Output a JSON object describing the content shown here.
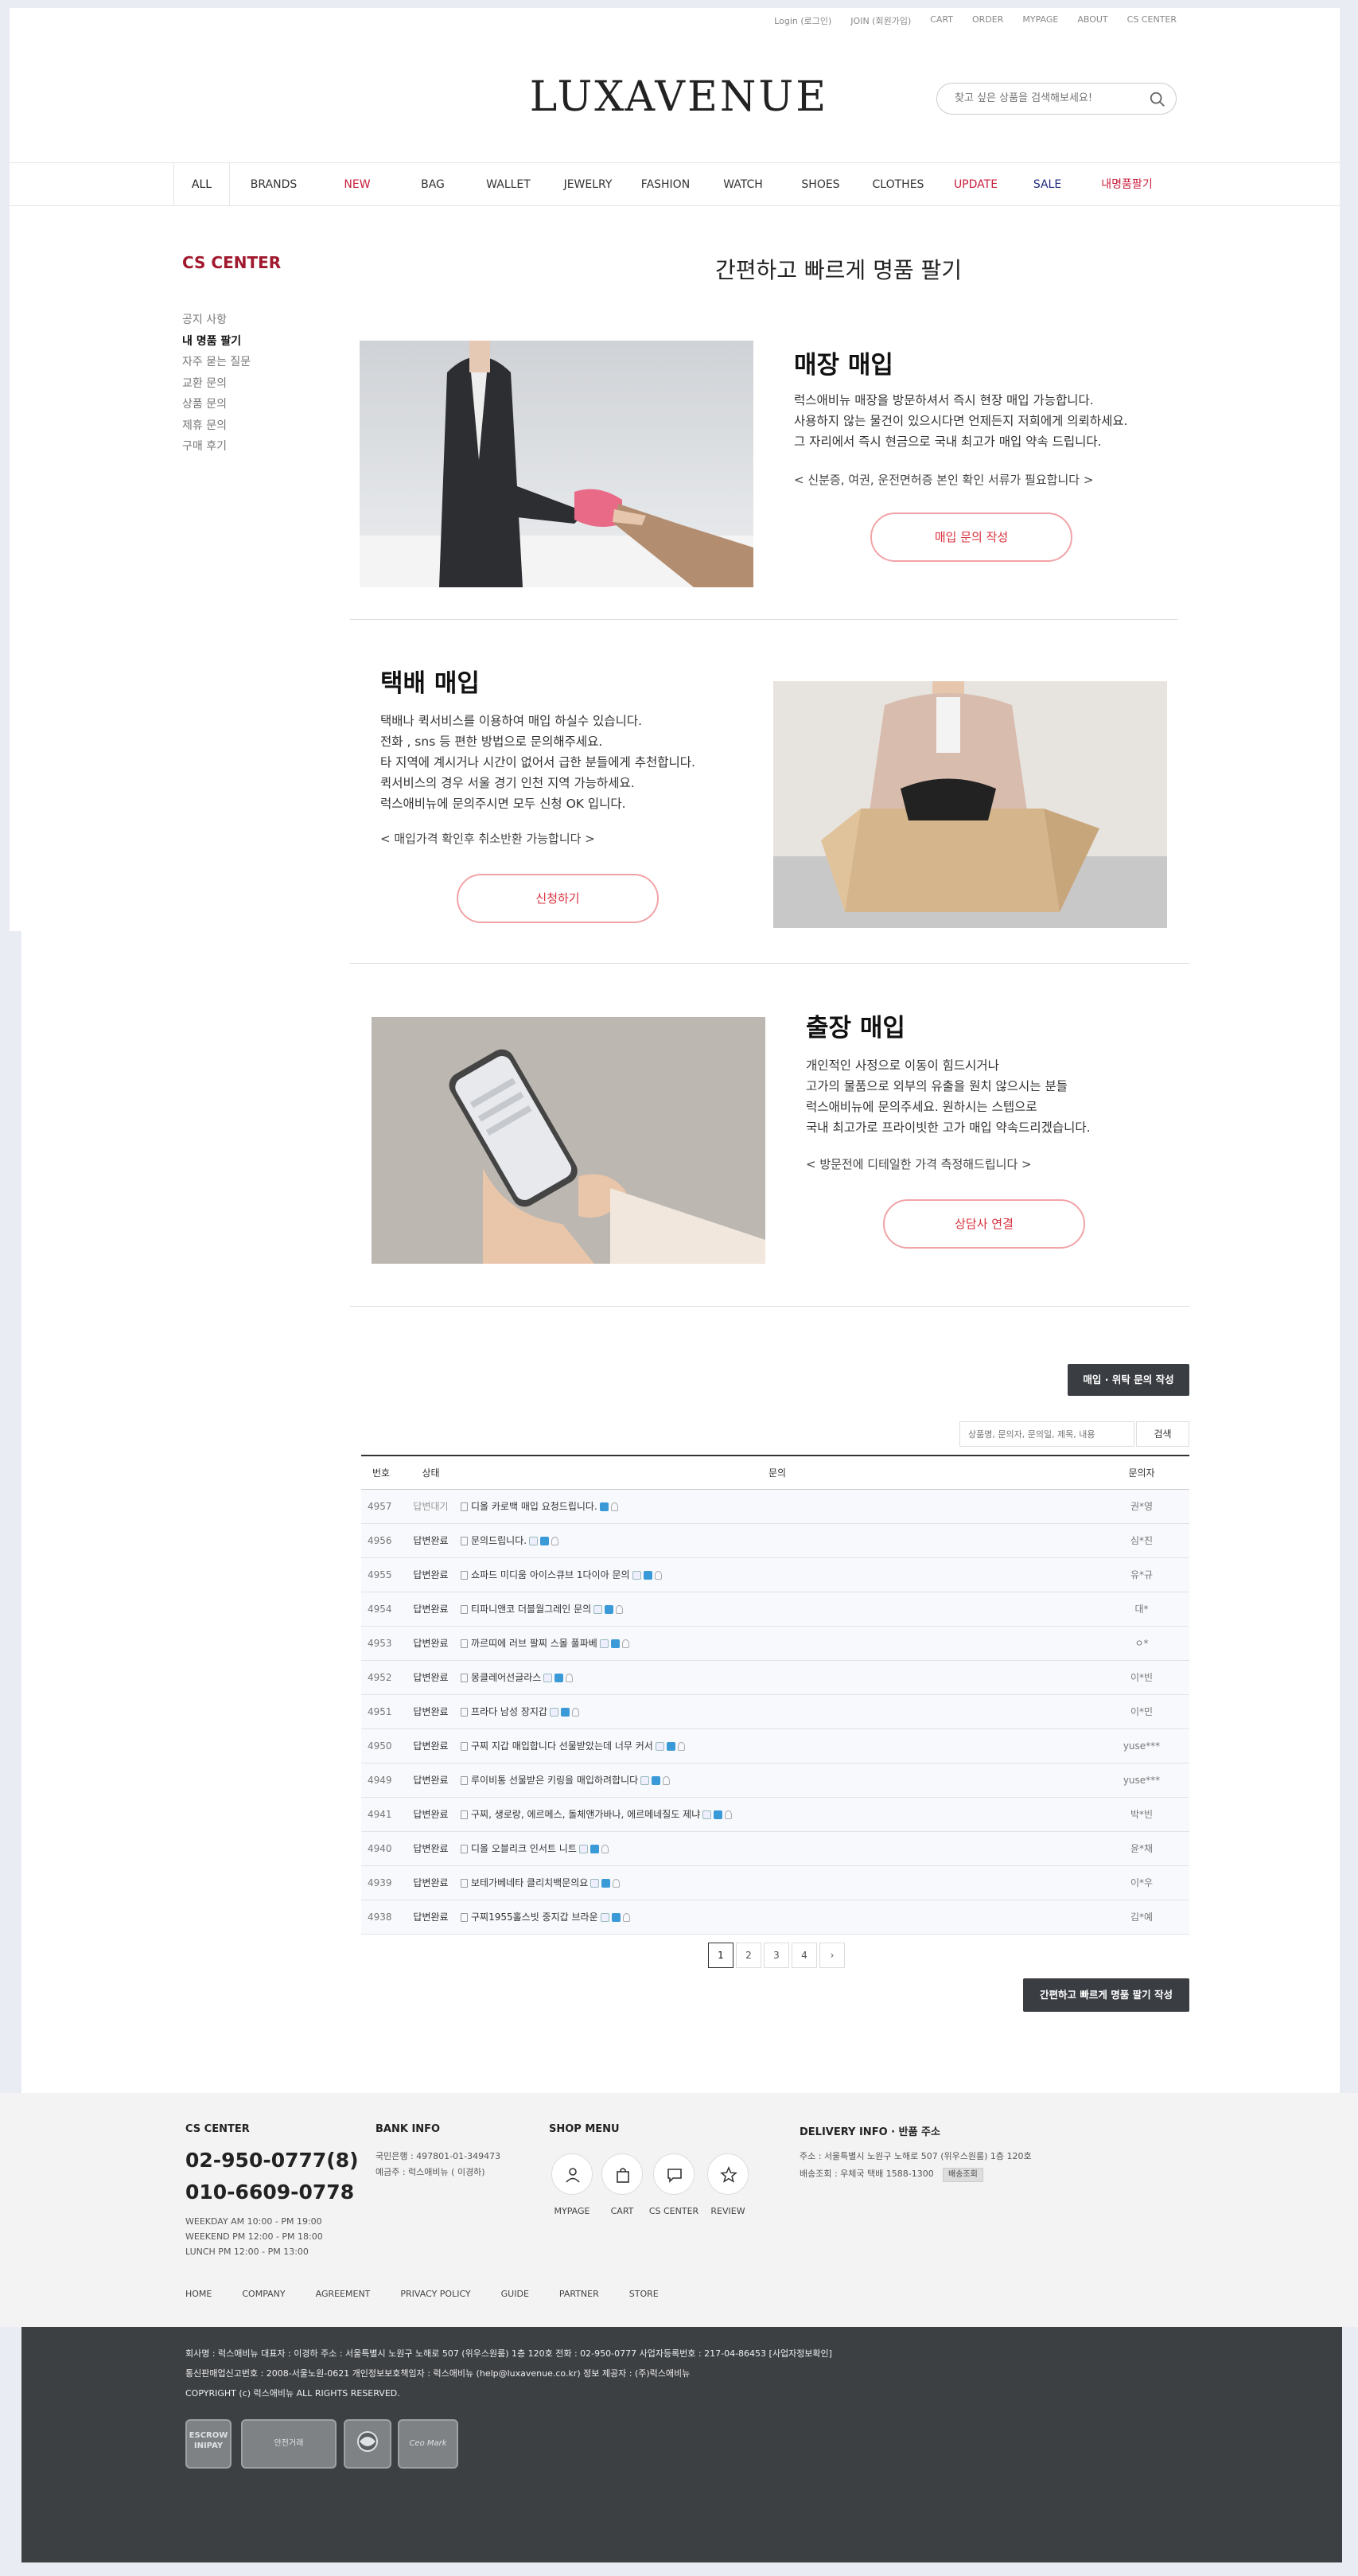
{
  "header": {
    "topnav": [
      "Login (로그인)",
      "JOIN (회원가입)",
      "CART",
      "ORDER",
      "MYPAGE",
      "ABOUT",
      "CS CENTER"
    ],
    "logo": "LUXAVENUE",
    "search_placeholder": "찾고 싶은 상품을 검색해보세요!"
  },
  "gnb": [
    {
      "label": "ALL",
      "color": "#222"
    },
    {
      "label": "BRANDS",
      "color": "#333"
    },
    {
      "label": "NEW",
      "color": "#c81e3c"
    },
    {
      "label": "BAG",
      "color": "#333"
    },
    {
      "label": "WALLET",
      "color": "#333"
    },
    {
      "label": "JEWELRY",
      "color": "#333"
    },
    {
      "label": "FASHION",
      "color": "#333"
    },
    {
      "label": "WATCH",
      "color": "#333"
    },
    {
      "label": "SHOES",
      "color": "#333"
    },
    {
      "label": "CLOTHES",
      "color": "#333"
    },
    {
      "label": "UPDATE",
      "color": "#c81e3c"
    },
    {
      "label": "SALE",
      "color": "#1c2a7a"
    },
    {
      "label": "내명품팔기",
      "color": "#c81e3c"
    }
  ],
  "sidebar": {
    "title": "CS CENTER",
    "items": [
      "공지 사항",
      "내 명품 팔기",
      "자주 묻는 질문",
      "교환 문의",
      "상품 문의",
      "제휴 문의",
      "구매 후기"
    ],
    "active_index": 1
  },
  "page_title": "간편하고 빠르게 명품 팔기",
  "sections": [
    {
      "title": "매장 매입",
      "lines": [
        "럭스애비뉴 매장을 방문하셔서 즉시 현장 매입 가능합니다.",
        "사용하지 않는 물건이 있으시다면 언제든지 저희에게 의뢰하세요.",
        "그 자리에서 즉시 현금으로 국내 최고가 매입 약속 드립니다."
      ],
      "note": "< 신분증, 여권, 운전면허증 본인 확인 서류가 필요합니다 >",
      "button": "매입 문의 작성"
    },
    {
      "title": "택배 매입",
      "lines": [
        "택배나 퀵서비스를 이용하여 매입 하실수 있습니다.",
        "전화 , sns 등 편한 방법으로 문의해주세요.",
        "타 지역에 계시거나 시간이 없어서 급한 분들에게 추천합니다.",
        "퀵서비스의 경우 서울 경기 인천 지역 가능하세요.",
        "럭스애비뉴에 문의주시면 모두 신청 OK 입니다."
      ],
      "note": "< 매입가격 확인후 취소반환 가능합니다 >",
      "button": "신청하기"
    },
    {
      "title": "출장 매입",
      "lines": [
        "개인적인 사정으로 이동이 힘드시거나",
        "고가의 물품으로 외부의 유출을 원치 않으시는 분들",
        "럭스애비뉴에 문의주세요. 원하시는 스텝으로",
        "국내 최고가로 프라이빗한 고가 매입 약속드리겠습니다."
      ],
      "note": "< 방문전에 디테일한 가격 측정해드립니다 >",
      "button": "상담사 연결"
    }
  ],
  "board": {
    "write_top": "매입 · 위탁 문의 작성",
    "search_placeholder": "상품명, 문의자, 문의일, 제목, 내용",
    "search_button": "검색",
    "columns": [
      "번호",
      "상태",
      "문의",
      "문의자"
    ],
    "rows": [
      {
        "no": "4957",
        "status": "답변대기",
        "title": "디올 카로백 매입 요청드립니다.",
        "writer": "권*영",
        "icons": [
          "n",
          "l"
        ]
      },
      {
        "no": "4956",
        "status": "답변완료",
        "title": "문의드립니다.",
        "writer": "심*진",
        "icons": [
          "p",
          "n",
          "l"
        ]
      },
      {
        "no": "4955",
        "status": "답변완료",
        "title": "쇼파드 미디움 아이스큐브 1다이아 문의",
        "writer": "유*규",
        "icons": [
          "p",
          "n",
          "l"
        ]
      },
      {
        "no": "4954",
        "status": "답변완료",
        "title": "티파니앤코 더블월그레인 문의",
        "writer": "대*",
        "icons": [
          "p",
          "n",
          "l"
        ]
      },
      {
        "no": "4953",
        "status": "답변완료",
        "title": "까르띠에 러브 팔찌 스몰 풀파베",
        "writer": "ㅇ*",
        "icons": [
          "p",
          "n",
          "l"
        ]
      },
      {
        "no": "4952",
        "status": "답변완료",
        "title": "몽클레어선글라스",
        "writer": "이*빈",
        "icons": [
          "p",
          "n",
          "l"
        ]
      },
      {
        "no": "4951",
        "status": "답변완료",
        "title": "프라다 남성 장지갑",
        "writer": "이*민",
        "icons": [
          "p",
          "n",
          "l"
        ]
      },
      {
        "no": "4950",
        "status": "답변완료",
        "title": "구찌 지갑 매입합니다 선물받았는데 너무 커서",
        "writer": "yuse***",
        "icons": [
          "p",
          "n",
          "l"
        ]
      },
      {
        "no": "4949",
        "status": "답변완료",
        "title": "루이비통 선물받은 키링을 매입하려합니다",
        "writer": "yuse***",
        "icons": [
          "p",
          "n",
          "l"
        ]
      },
      {
        "no": "4941",
        "status": "답변완료",
        "title": "구찌, 생로랑, 에르메스, 돌체앤가바나, 에르메네질도 제냐",
        "writer": "박*빈",
        "icons": [
          "p",
          "n",
          "l"
        ]
      },
      {
        "no": "4940",
        "status": "답변완료",
        "title": "디올 오블리크 인서트 니트",
        "writer": "윤*채",
        "icons": [
          "p",
          "n",
          "l"
        ]
      },
      {
        "no": "4939",
        "status": "답변완료",
        "title": "보테가베네타 클리치백문의요",
        "writer": "이*우",
        "icons": [
          "p",
          "n",
          "l"
        ]
      },
      {
        "no": "4938",
        "status": "답변완료",
        "title": "구찌1955홀스빗 중지갑 브라운",
        "writer": "김*예",
        "icons": [
          "p",
          "n",
          "l"
        ]
      }
    ],
    "pages": [
      "1",
      "2",
      "3",
      "4",
      "›"
    ],
    "current_page": "1",
    "write_bottom": "간편하고 빠르게 명품 팔기 작성"
  },
  "footer": {
    "cs": {
      "title": "CS CENTER",
      "phone1": "02-950-0777(8)",
      "phone2": "010-6609-0778",
      "hours": [
        "WEEKDAY  AM 10:00 - PM 19:00",
        "WEEKEND  PM 12:00 - PM 18:00",
        "LUNCH  PM 12:00 - PM 13:00"
      ]
    },
    "bank": {
      "title": "BANK INFO",
      "lines": [
        "국민은행 : 497801-01-349473",
        "예금주 : 럭스애비뉴 ( 이경하)"
      ]
    },
    "shop": {
      "title": "SHOP MENU",
      "items": [
        "MYPAGE",
        "CART",
        "CS CENTER",
        "REVIEW"
      ]
    },
    "delivery": {
      "title": "DELIVERY INFO · 반품 주소",
      "address": "주소 : 서울특별시 노원구 노해로 507 (위우스원룸) 1층 120호",
      "courier": "배송조회 : 우체국 택배 1588-1300",
      "track_button": "배송조회"
    },
    "links": [
      "HOME",
      "COMPANY",
      "AGREEMENT",
      "PRIVACY POLICY",
      "GUIDE",
      "PARTNER",
      "STORE"
    ],
    "company_lines": [
      "회사명 : 럭스애비뉴        대표자 : 이경하        주소 : 서울특별시 노원구 노해로 507 (위우스원룸) 1층 120호        전화 : 02-950-0777        사업자등록번호 : 217-04-86453 [사업자정보확인]",
      "통신판매업신고번호 : 2008-서울노원-0621        개인정보보호책임자 : 럭스애비뉴 (help@luxavenue.co.kr)        정보 제공자 : (주)럭스애비뉴",
      "COPYRIGHT (c) 럭스애비뉴 ALL RIGHTS RESERVED."
    ],
    "badges": [
      "ESCROW INIPAY",
      "안전거래",
      "",
      "Ceo Mark"
    ]
  }
}
